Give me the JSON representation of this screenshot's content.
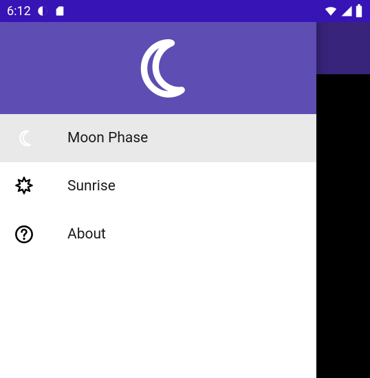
{
  "statusbar": {
    "time": "6:12"
  },
  "drawer": {
    "items": [
      {
        "label": "Moon Phase"
      },
      {
        "label": "Sunrise"
      },
      {
        "label": "About"
      }
    ]
  },
  "colors": {
    "statusbar": "#3614B6",
    "appbar": "#38247B",
    "drawerHeader": "#5E4DB2",
    "selectedItem": "#E9E9E9"
  }
}
